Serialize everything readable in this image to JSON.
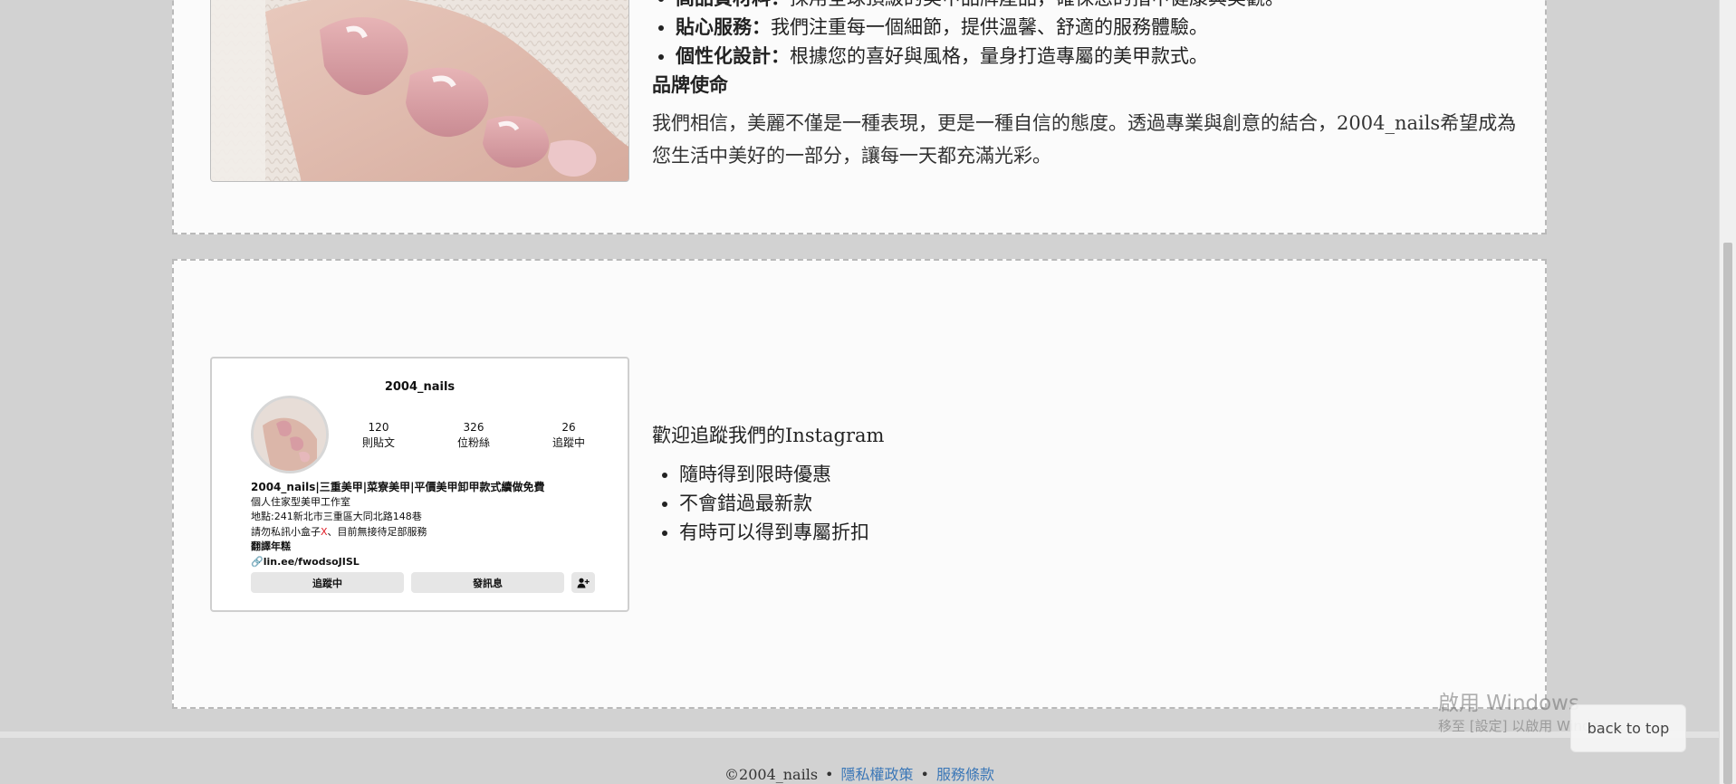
{
  "about": {
    "features": [
      {
        "title": "高品質材料：",
        "desc": "採用全球頂級的美甲品牌產品，確保您的指甲健康與美觀。"
      },
      {
        "title": "貼心服務：",
        "desc": "我們注重每一個細節，提供溫馨、舒適的服務體驗。"
      },
      {
        "title": "個性化設計：",
        "desc": "根據您的喜好與風格，量身打造專屬的美甲款式。"
      }
    ],
    "mission_title": "品牌使命",
    "mission_body": "我們相信，美麗不僅是一種表現，更是一種自信的態度。透過專業與創意的結合，2004_nails希望成為您生活中美好的一部分，讓每一天都充滿光彩。"
  },
  "instagram_card": {
    "handle": "2004_nails",
    "stats": [
      {
        "num": "120",
        "label": "則貼文"
      },
      {
        "num": "326",
        "label": "位粉絲"
      },
      {
        "num": "26",
        "label": "追蹤中"
      }
    ],
    "bio_name": "2004_nails|三重美甲|菜寮美甲|平價美甲卸甲款式續做免費",
    "bio_line1": "個人住家型美甲工作室",
    "bio_line2": "地點:241新北市三重區大同北路148巷",
    "bio_line3_a": "請勿私訊小盒子",
    "bio_line3_x": "X",
    "bio_line3_b": "、目前無接待足部服務",
    "bio_line4": "翻譯年糕",
    "bio_link": "🔗lin.ee/fwodsoJISL",
    "follow_label": "追蹤中",
    "message_label": "發訊息"
  },
  "instagram_promo": {
    "title": "歡迎追蹤我們的Instagram",
    "items": [
      "隨時得到限時優惠",
      "不會錯過最新款",
      "有時可以得到專屬折扣"
    ]
  },
  "footer": {
    "copyright": "©2004_nails",
    "bullet": "•",
    "privacy": "隱私權政策",
    "terms": "服務條款"
  },
  "watermark": {
    "line1": "啟用 Windows",
    "line2": "移至 [設定] 以啟用 Windows。"
  },
  "back_to_top": "back to top",
  "icons": {
    "add_person": "add-person-icon",
    "link": "link-icon"
  }
}
